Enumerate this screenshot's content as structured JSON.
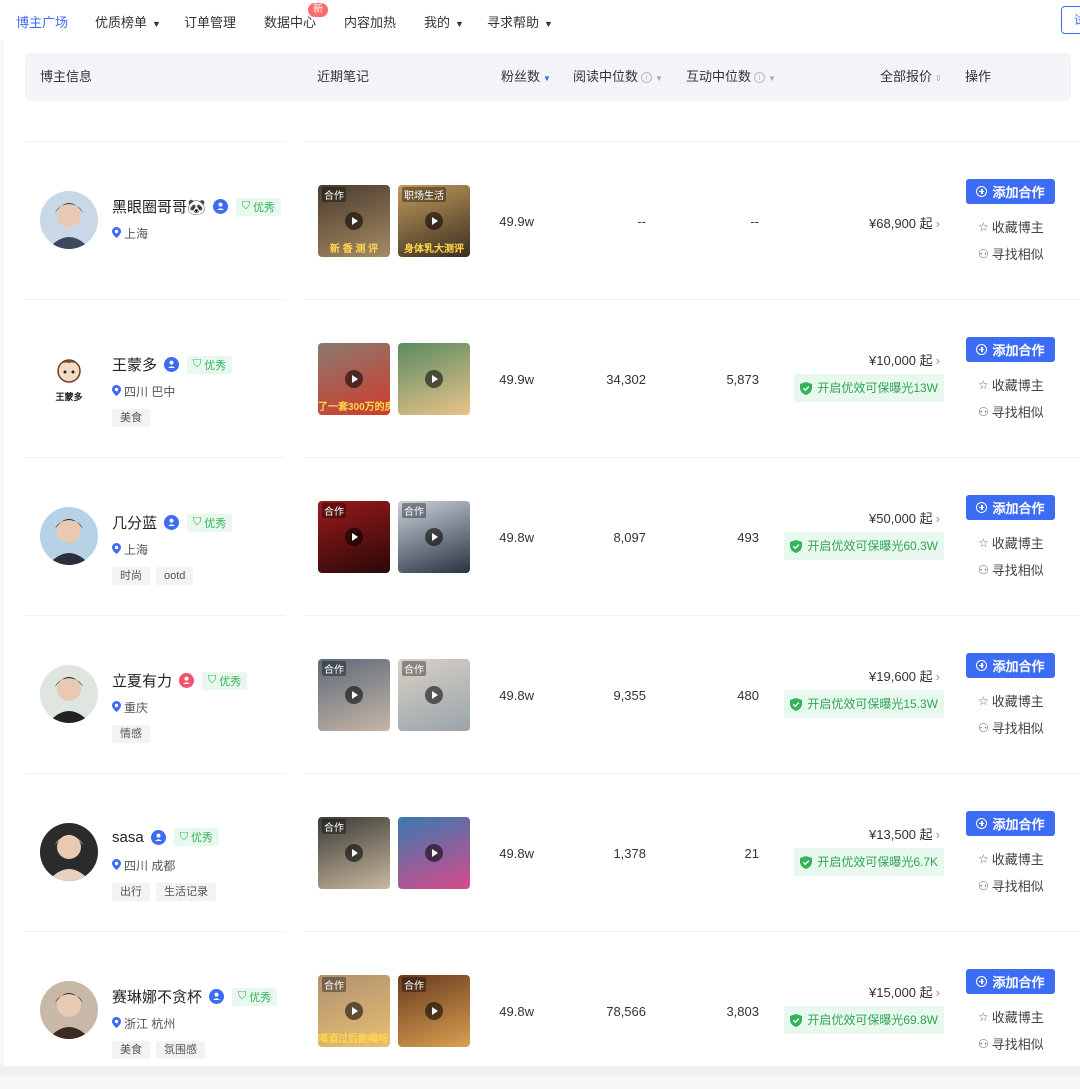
{
  "nav": {
    "items": [
      {
        "label": "博主广场",
        "active": true,
        "dropdown": false
      },
      {
        "label": "优质榜单",
        "active": false,
        "dropdown": true
      },
      {
        "label": "订单管理",
        "active": false,
        "dropdown": false
      },
      {
        "label": "数据中心",
        "active": false,
        "dropdown": false,
        "badge": "新"
      },
      {
        "label": "内容加热",
        "active": false,
        "dropdown": false
      },
      {
        "label": "我的",
        "active": false,
        "dropdown": true
      },
      {
        "label": "寻求帮助",
        "active": false,
        "dropdown": true
      }
    ],
    "right_button": "试"
  },
  "table": {
    "headers": {
      "blogger": "博主信息",
      "notes": "近期笔记",
      "fans": "粉丝数",
      "read": "阅读中位数",
      "interact": "互动中位数",
      "price": "全部报价",
      "ops": "操作"
    },
    "actions": {
      "add": "添加合作",
      "fav": "收藏博主",
      "similar": "寻找相似"
    },
    "rows": [
      {
        "name": "黑眼圈哥哥🐼",
        "badge_color": "#3d6cf4",
        "quality": "优秀",
        "location": "上海",
        "tags": [],
        "notes": [
          {
            "tag": "合作",
            "caption": "新 香 测 评"
          },
          {
            "tag": "职场生活",
            "caption": "身体乳大测评"
          }
        ],
        "fans": "49.9w",
        "read": "--",
        "interact": "--",
        "price": "¥68,900 起",
        "promo": ""
      },
      {
        "name": "王蒙多",
        "badge_color": "#3d6cf4",
        "quality": "优秀",
        "location": "四川 巴中",
        "tags": [
          "美食"
        ],
        "avatar_text": "王蒙多",
        "notes": [
          {
            "tag": "",
            "caption": "了一套300万的房"
          },
          {
            "tag": "",
            "caption": ""
          }
        ],
        "fans": "49.9w",
        "read": "34,302",
        "interact": "5,873",
        "price": "¥10,000 起",
        "promo": "开启优效可保曝光13W"
      },
      {
        "name": "几分蓝",
        "badge_color": "#3d6cf4",
        "quality": "优秀",
        "location": "上海",
        "tags": [
          "时尚",
          "ootd"
        ],
        "notes": [
          {
            "tag": "合作",
            "caption": ""
          },
          {
            "tag": "合作",
            "caption": ""
          }
        ],
        "fans": "49.8w",
        "read": "8,097",
        "interact": "493",
        "price": "¥50,000 起",
        "promo": "开启优效可保曝光60.3W"
      },
      {
        "name": "立夏有力",
        "badge_color": "#f2536b",
        "quality": "优秀",
        "location": "重庆",
        "tags": [
          "情感"
        ],
        "notes": [
          {
            "tag": "合作",
            "caption": ""
          },
          {
            "tag": "合作",
            "caption": ""
          }
        ],
        "fans": "49.8w",
        "read": "9,355",
        "interact": "480",
        "price": "¥19,600 起",
        "promo": "开启优效可保曝光15.3W"
      },
      {
        "name": "sasa",
        "badge_color": "#3d6cf4",
        "quality": "优秀",
        "location": "四川 成都",
        "tags": [
          "出行",
          "生活记录"
        ],
        "notes": [
          {
            "tag": "合作",
            "caption": ""
          },
          {
            "tag": "",
            "caption": ""
          }
        ],
        "fans": "49.8w",
        "read": "1,378",
        "interact": "21",
        "price": "¥13,500 起",
        "promo": "开启优效可保曝光6.7K"
      },
      {
        "name": "赛琳娜不贪杯",
        "badge_color": "#3d6cf4",
        "quality": "优秀",
        "location": "浙江 杭州",
        "tags": [
          "美食",
          "氛围感"
        ],
        "notes": [
          {
            "tag": "合作",
            "caption": "喝酒过后能喝吗?"
          },
          {
            "tag": "合作",
            "caption": ""
          }
        ],
        "fans": "49.8w",
        "read": "78,566",
        "interact": "3,803",
        "price": "¥15,000 起",
        "promo": "开启优效可保曝光69.8W"
      }
    ]
  },
  "colors": {
    "accent": "#3d6cf4",
    "success": "#33b35a"
  }
}
